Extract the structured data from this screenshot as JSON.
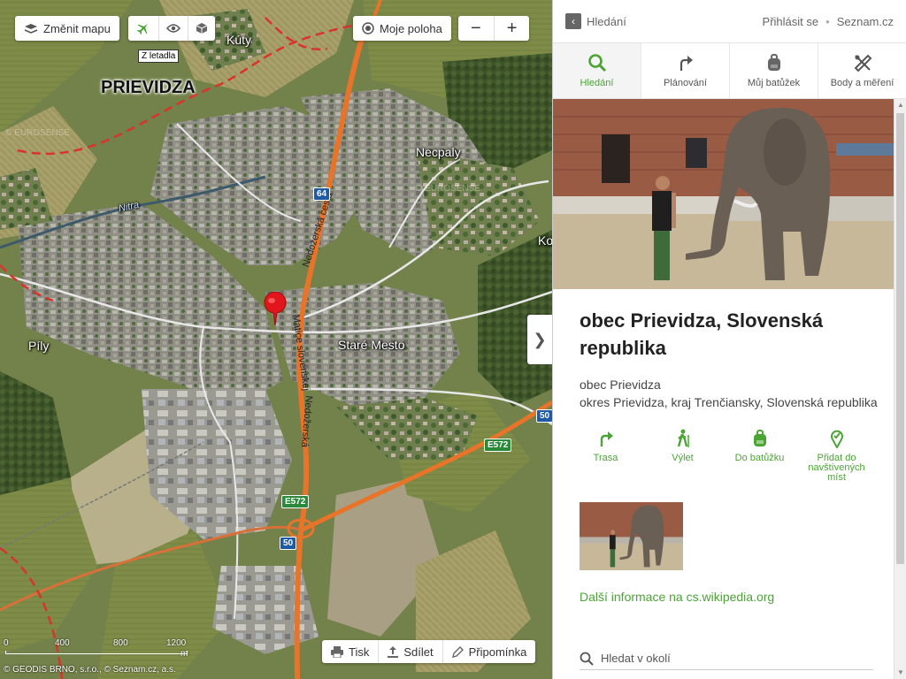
{
  "map": {
    "controls": {
      "change_map": "Změnit mapu",
      "my_location": "Moje poloha",
      "zoom_out": "−",
      "zoom_in": "+",
      "tooltip": "Z letadla"
    },
    "labels": {
      "city": "PRIEVIDZA",
      "kuty": "Kúty",
      "necpaly": "Necpaly",
      "stare_mesto": "Staré Mesto",
      "pily": "Píly",
      "ko": "Ko",
      "river": "Nitra",
      "road1": "Nedožerská cesta",
      "road2": "Matice slovenskej",
      "road3": "Nedožerská",
      "watermark": "© EUROSENSE"
    },
    "shields": {
      "r64": "64",
      "e572a": "E572",
      "e572b": "E572",
      "r50a": "50",
      "r50b": "50"
    },
    "scale": {
      "t0": "0",
      "t1": "400",
      "t2": "800",
      "t3": "1200",
      "unit": "m"
    },
    "attribution": "© GEODIS BRNO, s.r.o., © Seznam.cz, a.s.",
    "tools": {
      "print": "Tisk",
      "share": "Sdílet",
      "note": "Připomínka"
    },
    "collapse_arrow": "❯"
  },
  "panel": {
    "back_label": "Hledání",
    "login": "Přihlásit se",
    "brand": "Seznam.cz",
    "tabs": [
      {
        "label": "Hledání",
        "icon": "search-icon",
        "active": true
      },
      {
        "label": "Plánování",
        "icon": "route-icon",
        "active": false
      },
      {
        "label": "Můj batůžek",
        "icon": "backpack-icon",
        "active": false
      },
      {
        "label": "Body a měření",
        "icon": "ruler-icon",
        "active": false
      }
    ],
    "title": "obec Prievidza, Slovenská republika",
    "address_line1": "obec Prievidza",
    "address_line2": "okres Prievidza, kraj Trenčiansky, Slovenská republika",
    "actions": [
      {
        "label": "Trasa",
        "icon": "route-icon"
      },
      {
        "label": "Výlet",
        "icon": "hiker-icon"
      },
      {
        "label": "Do batůžku",
        "icon": "backpack-icon"
      },
      {
        "label": "Přidat do navštívených míst",
        "icon": "checkpin-icon"
      }
    ],
    "wiki_link": "Další informace na cs.wikipedia.org",
    "nearby": "Hledat v okolí"
  },
  "colors": {
    "accent": "#4aa535",
    "road_orange": "#e8742a",
    "marker": "#e0161c",
    "boundary": "#d9332b"
  }
}
